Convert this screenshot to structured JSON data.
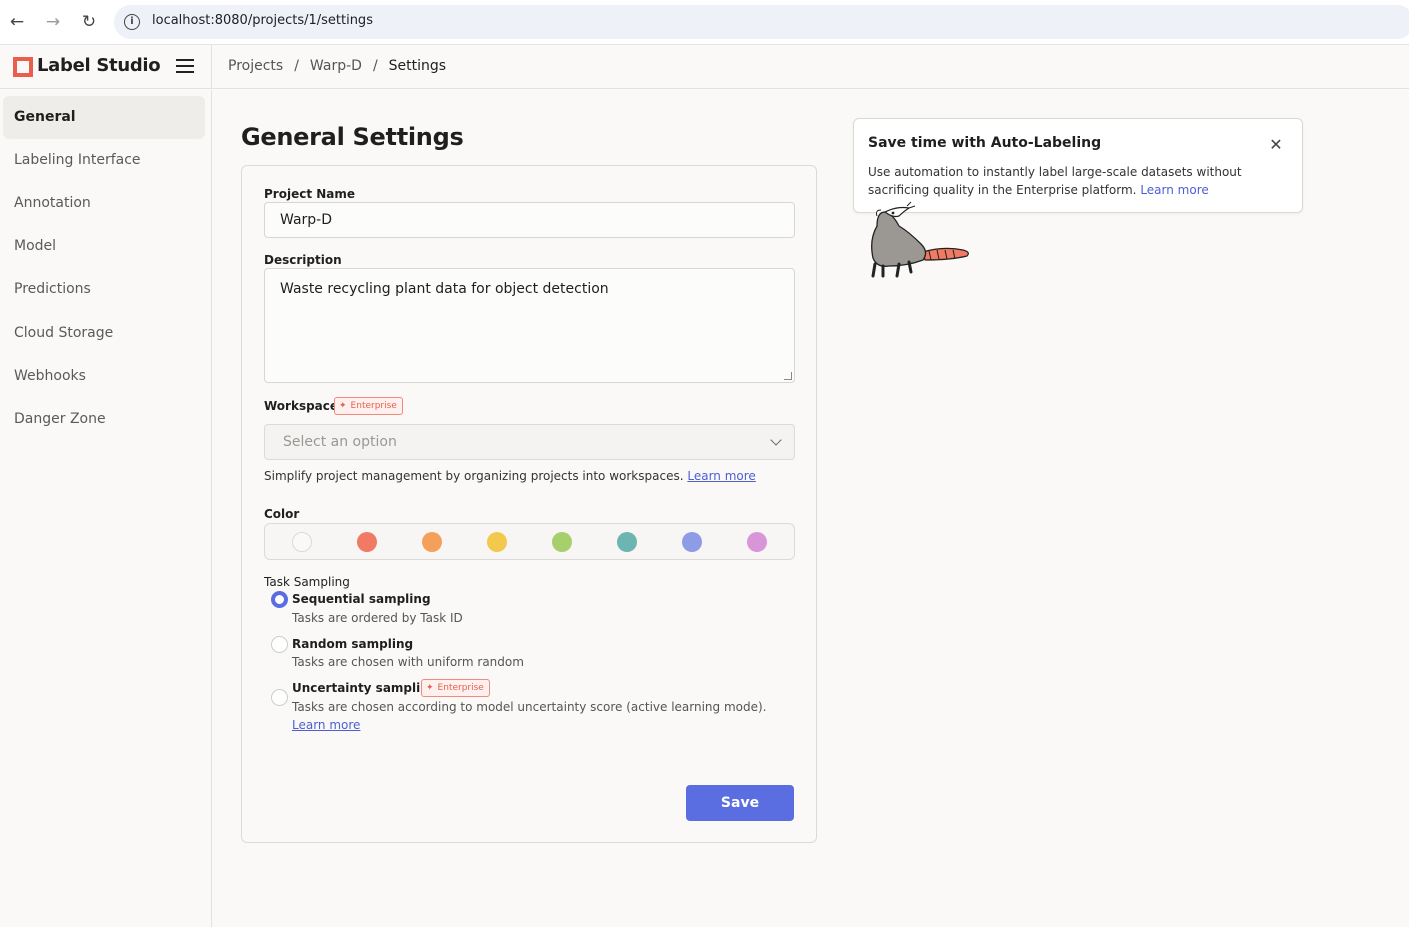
{
  "browser": {
    "url": "localhost:8080/projects/1/settings"
  },
  "app": {
    "name": "Label Studio"
  },
  "breadcrumb": [
    "Projects",
    "Warp-D",
    "Settings"
  ],
  "sidebar": {
    "items": [
      {
        "label": "General",
        "active": true
      },
      {
        "label": "Labeling Interface"
      },
      {
        "label": "Annotation"
      },
      {
        "label": "Model"
      },
      {
        "label": "Predictions"
      },
      {
        "label": "Cloud Storage"
      },
      {
        "label": "Webhooks"
      },
      {
        "label": "Danger Zone"
      }
    ]
  },
  "page": {
    "title": "General Settings"
  },
  "form": {
    "project_name_label": "Project Name",
    "project_name_value": "Warp-D",
    "description_label": "Description",
    "description_value": "Waste recycling plant data for object detection",
    "workspace_label": "Workspace",
    "enterprise_badge": "Enterprise",
    "workspace_placeholder": "Select an option",
    "workspace_help": "Simplify project management by organizing projects into workspaces.",
    "workspace_help_link": "Learn more",
    "color_label": "Color",
    "colors": [
      "#faf9f7",
      "#f07a63",
      "#f5a05a",
      "#f2c94c",
      "#a7cf6b",
      "#6db5b0",
      "#8e9be6",
      "#d895d8"
    ],
    "task_sampling_label": "Task Sampling",
    "sampling_options": [
      {
        "title": "Sequential sampling",
        "desc": "Tasks are ordered by Task ID",
        "checked": true
      },
      {
        "title": "Random sampling",
        "desc": "Tasks are chosen with uniform random",
        "checked": false
      },
      {
        "title": "Uncertainty sampling",
        "desc": "Tasks are chosen according to model uncertainty score (active learning mode).",
        "link": "Learn more",
        "checked": false
      }
    ],
    "save_label": "Save"
  },
  "promo": {
    "title": "Save time with Auto-Labeling",
    "body": "Use automation to instantly label large-scale datasets without sacrificing quality in the Enterprise platform.",
    "link": "Learn more"
  },
  "accent_color": "#5b6ee1",
  "brand_color": "#e8604c"
}
